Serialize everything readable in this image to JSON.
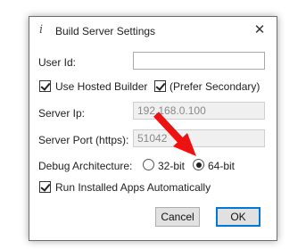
{
  "window": {
    "title": "Build Server Settings",
    "icon": "info-icon",
    "close_icon": "close-icon",
    "close_glyph": "✕"
  },
  "form": {
    "user_id_label": "User Id:",
    "user_id_value": "",
    "use_hosted_builder_label": "Use Hosted Builder",
    "use_hosted_builder_checked": true,
    "prefer_secondary_label": "(Prefer Secondary)",
    "prefer_secondary_checked": true,
    "server_ip_label": "Server Ip:",
    "server_ip_value": "192.168.0.100",
    "server_port_label": "Server Port (https):",
    "server_port_value": "51042",
    "debug_arch_label": "Debug Architecture:",
    "arch_options": [
      "32-bit",
      "64-bit"
    ],
    "arch_selected": "64-bit",
    "run_installed_label": "Run Installed Apps Automatically",
    "run_installed_checked": true
  },
  "buttons": {
    "cancel_label": "Cancel",
    "ok_label": "OK"
  },
  "colors": {
    "arrow": "#ee1111",
    "focus": "#0078d7"
  }
}
